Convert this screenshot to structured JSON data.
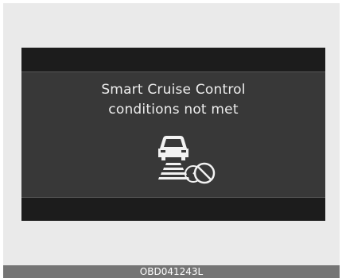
{
  "display": {
    "message_line1": "Smart Cruise Control",
    "message_line2": "conditions not met",
    "icon": "smart-cruise-control-unavailable-icon"
  },
  "caption": {
    "code": "OBD041243L"
  },
  "colors": {
    "screen_bg": "#383838",
    "screen_bar": "#1c1c1c",
    "text": "#ededed",
    "caption_bg": "#757575",
    "outer_bg": "#eaeaea"
  }
}
